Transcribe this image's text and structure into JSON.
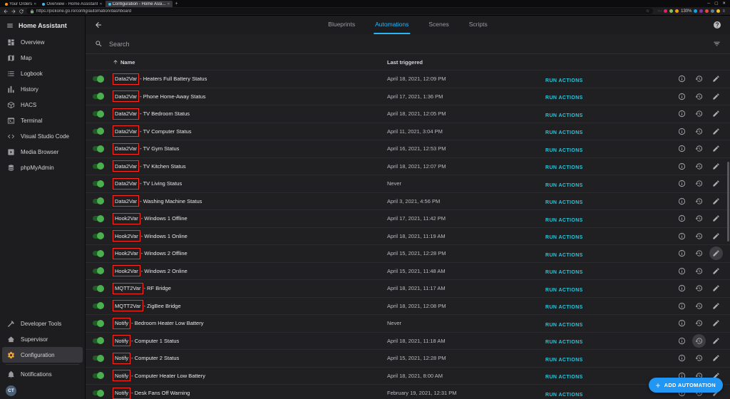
{
  "browser": {
    "tabs": [
      {
        "title": "Your Orders"
      },
      {
        "title": "Overview - Home Assistant"
      },
      {
        "title": "Configuration - Home Assi..."
      }
    ],
    "url": "https://pickone.go.ro/config/automation/dashboard",
    "zoom_level": "130%"
  },
  "sidebar": {
    "title": "Home Assistant",
    "active_item": "Configuration",
    "avatar_initials": "CT",
    "items": [
      {
        "label": "Overview",
        "icon": "view-dashboard-icon"
      },
      {
        "label": "Map",
        "icon": "map-icon"
      },
      {
        "label": "Logbook",
        "icon": "logbook-icon"
      },
      {
        "label": "History",
        "icon": "history-chart-icon"
      },
      {
        "label": "HACS",
        "icon": "hacs-icon"
      },
      {
        "label": "Terminal",
        "icon": "terminal-icon"
      },
      {
        "label": "Visual Studio Code",
        "icon": "vscode-icon"
      },
      {
        "label": "Media Browser",
        "icon": "media-browser-icon"
      },
      {
        "label": "phpMyAdmin",
        "icon": "database-icon"
      }
    ],
    "bottom_items": [
      {
        "label": "Developer Tools",
        "icon": "hammer-icon"
      },
      {
        "label": "Supervisor",
        "icon": "home-icon"
      },
      {
        "label": "Configuration",
        "icon": "gear-icon"
      }
    ],
    "footer_items": [
      {
        "label": "Notifications",
        "icon": "bell-icon"
      }
    ]
  },
  "header": {
    "tabs": [
      {
        "label": "Blueprints"
      },
      {
        "label": "Automations"
      },
      {
        "label": "Scenes"
      },
      {
        "label": "Scripts"
      }
    ],
    "active_tab": "Automations"
  },
  "search": {
    "placeholder": "Search"
  },
  "table": {
    "name_header": "Name",
    "last_triggered_header": "Last triggered",
    "run_actions_label": "RUN ACTIONS"
  },
  "rows": [
    {
      "prefix": "Data2Var",
      "rest": " - Heaters Full Battery Status",
      "last": "April 18, 2021, 12:09 PM"
    },
    {
      "prefix": "Data2Var",
      "rest": " - Phone Home-Away Status",
      "last": "April 17, 2021, 1:36 PM"
    },
    {
      "prefix": "Data2Var",
      "rest": " - TV Bedroom Status",
      "last": "April 18, 2021, 12:05 PM"
    },
    {
      "prefix": "Data2Var",
      "rest": " - TV Computer Status",
      "last": "April 11, 2021, 3:04 PM"
    },
    {
      "prefix": "Data2Var",
      "rest": " - TV Gym Status",
      "last": "April 16, 2021, 12:53 PM"
    },
    {
      "prefix": "Data2Var",
      "rest": " - TV Kitchen Status",
      "last": "April 18, 2021, 12:07 PM"
    },
    {
      "prefix": "Data2Var",
      "rest": " - TV Living Status",
      "last": "Never"
    },
    {
      "prefix": "Data2Var",
      "rest": " - Washing Machine Status",
      "last": "April 3, 2021, 4:56 PM"
    },
    {
      "prefix": "Hook2Var",
      "rest": " - Windows 1 Offline",
      "last": "April 17, 2021, 11:42 PM"
    },
    {
      "prefix": "Hook2Var",
      "rest": " - Windows 1 Online",
      "last": "April 18, 2021, 11:19 AM"
    },
    {
      "prefix": "Hook2Var",
      "rest": " - Windows 2 Offline",
      "last": "April 15, 2021, 12:28 PM"
    },
    {
      "prefix": "Hook2Var",
      "rest": " - Windows 2 Online",
      "last": "April 15, 2021, 11:48 AM"
    },
    {
      "prefix": "MQTT2Var",
      "rest": " - RF Bridge",
      "last": "April 18, 2021, 11:17 AM"
    },
    {
      "prefix": "MQTT2Var",
      "rest": " - ZigBee Bridge",
      "last": "April 18, 2021, 12:08 PM"
    },
    {
      "prefix": "Notify",
      "rest": " - Bedroom Heater Low Battery",
      "last": "Never"
    },
    {
      "prefix": "Notify",
      "rest": " - Computer 1 Status",
      "last": "April 18, 2021, 11:18 AM"
    },
    {
      "prefix": "Notify",
      "rest": " - Computer 2 Status",
      "last": "April 15, 2021, 12:28 PM"
    },
    {
      "prefix": "Notify",
      "rest": " - Computer Heater Low Battery",
      "last": "April 18, 2021, 8:00 AM"
    },
    {
      "prefix": "Notify",
      "rest": " - Desk Fans Off Warning",
      "last": "February 19, 2021, 12:31 PM"
    }
  ],
  "fab": {
    "label": "ADD AUTOMATION"
  },
  "colors": {
    "accent-cyan": "#29b6f6",
    "run-actions": "#2bc4d9",
    "toggle-track": "#1f5c24",
    "toggle-thumb": "#4caf50",
    "fab-blue": "#2196f3",
    "annotation-red": "#ff2a1f"
  }
}
